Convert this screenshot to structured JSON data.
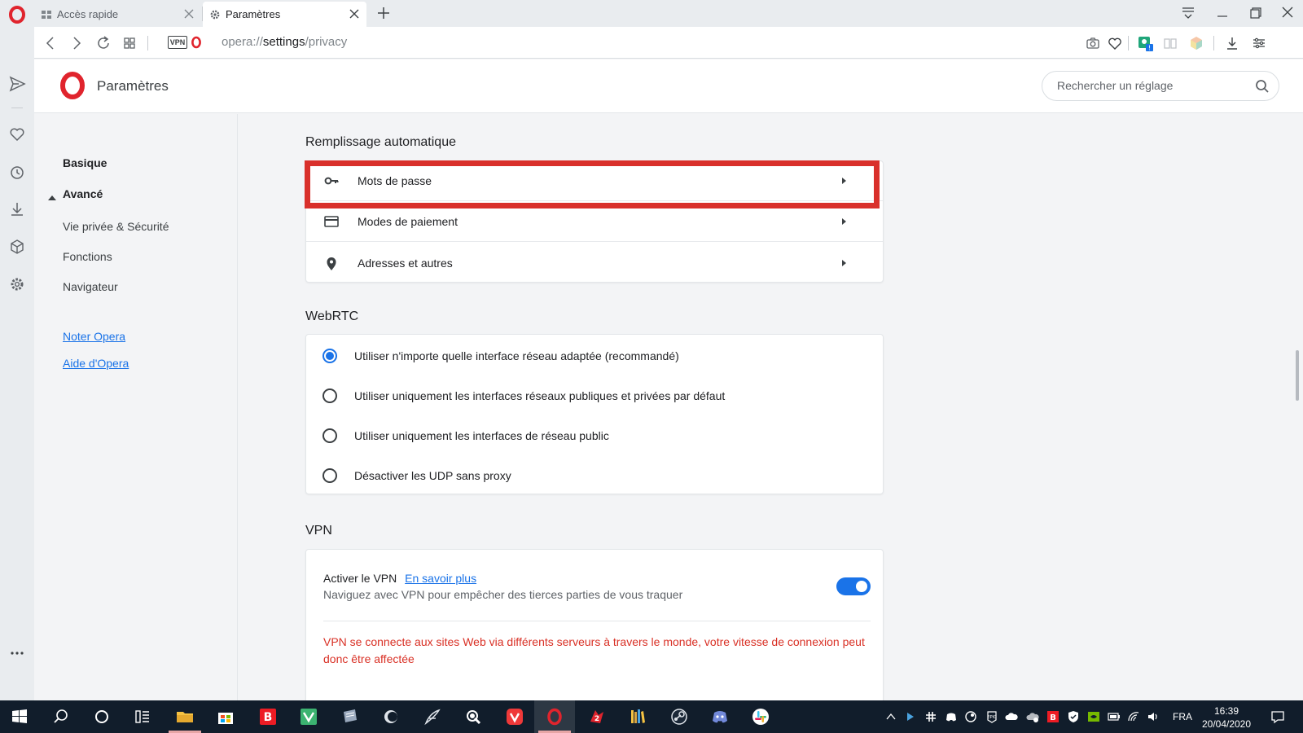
{
  "tabs": [
    {
      "label": "Accès rapide",
      "active": false
    },
    {
      "label": "Paramètres",
      "active": true
    }
  ],
  "address": {
    "vpn_badge": "VPN",
    "url_prefix": "opera://",
    "url_host": "settings",
    "url_path": "/privacy"
  },
  "settings": {
    "title": "Paramètres",
    "search_placeholder": "Rechercher un réglage"
  },
  "nav": {
    "basic": "Basique",
    "advanced": "Avancé",
    "items": [
      "Vie privée & Sécurité",
      "Fonctions",
      "Navigateur"
    ],
    "links": [
      "Noter Opera",
      "Aide d'Opera"
    ]
  },
  "autofill": {
    "title": "Remplissage automatique",
    "rows": [
      {
        "label": "Mots de passe",
        "icon": "key-icon"
      },
      {
        "label": "Modes de paiement",
        "icon": "credit-card-icon"
      },
      {
        "label": "Adresses et autres",
        "icon": "location-pin-icon"
      }
    ]
  },
  "webrtc": {
    "title": "WebRTC",
    "options": [
      {
        "label": "Utiliser n'importe quelle interface réseau adaptée (recommandé)",
        "checked": true
      },
      {
        "label": "Utiliser uniquement les interfaces réseaux publiques et privées par défaut",
        "checked": false
      },
      {
        "label": "Utiliser uniquement les interfaces de réseau public",
        "checked": false
      },
      {
        "label": "Désactiver les UDP sans proxy",
        "checked": false
      }
    ]
  },
  "vpn": {
    "title": "VPN",
    "enable_label": "Activer le VPN",
    "learn_more": "En savoir plus",
    "description": "Naviguez avec VPN pour empêcher des tierces parties de vous traquer",
    "enabled": true,
    "warning": "VPN se connecte aux sites Web via différents serveurs à travers le monde, votre vitesse de connexion peut donc être affectée"
  },
  "taskbar": {
    "language": "FRA",
    "time": "16:39",
    "date": "20/04/2020"
  },
  "colors": {
    "accent": "#1a73e8",
    "highlight_border": "#d9302b",
    "warning_text": "#d93025",
    "opera_red": "#e0242d",
    "taskbar_bg": "#111d2b"
  }
}
